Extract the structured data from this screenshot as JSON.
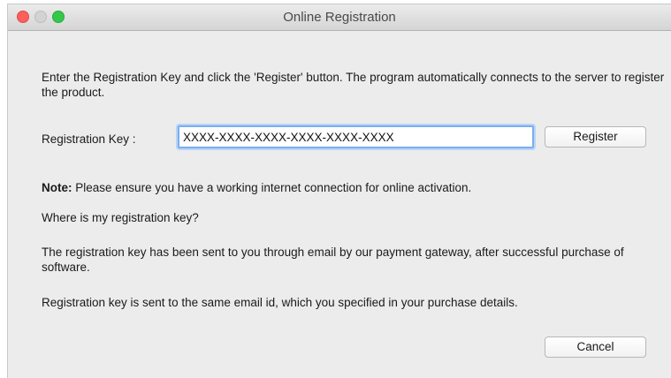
{
  "window": {
    "title": "Online Registration"
  },
  "intro_text": "Enter the Registration Key and click the 'Register' button. The program automatically connects to the server to register the product.",
  "registration": {
    "label": "Registration Key :",
    "value": "XXXX-XXXX-XXXX-XXXX-XXXX-XXXX",
    "register_label": "Register"
  },
  "note": {
    "prefix": "Note:",
    "text": "Please ensure you have a working internet connection for online activation."
  },
  "help": {
    "question": "Where is my registration key?",
    "answer_1": "The registration key has been sent to you through email by our payment gateway, after successful purchase of software.",
    "answer_2": "Registration key is sent to the same email id, which you specified in your purchase details."
  },
  "buttons": {
    "cancel_label": "Cancel"
  },
  "colors": {
    "close": "#fc605c",
    "minimize": "#d3d3d3",
    "zoom": "#34c84a",
    "focus_ring": "#7aaef0"
  }
}
